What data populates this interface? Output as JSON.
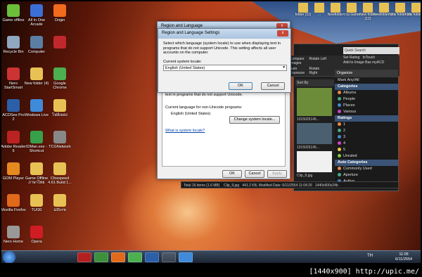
{
  "desktop": {
    "icons": [
      {
        "label": "Game offline",
        "color": "#6bbf3a"
      },
      {
        "label": "Recycle Bin",
        "color": "#8fa7bf"
      },
      {
        "label": "Nero StartSmart",
        "color": "#c33"
      },
      {
        "label": "ACDSee Pro 2",
        "color": "#2c5fa8"
      },
      {
        "label": "Adobe Reader 9",
        "color": "#b22"
      },
      {
        "label": "GOM Player",
        "color": "#e48a1f"
      },
      {
        "label": "Mozilla Firefox",
        "color": "#e06a1a"
      },
      {
        "label": "Nero Home",
        "color": "#999"
      },
      {
        "label": "All In One Arcade",
        "color": "#3b6fd6"
      },
      {
        "label": "Computer",
        "color": "#5b7fa3"
      },
      {
        "label": "New folder (4)",
        "color": "#e8c155"
      },
      {
        "label": "Windows Live",
        "color": "#3f8ad9"
      },
      {
        "label": "IDMan.exe - Shortcut",
        "color": "#38a04a"
      },
      {
        "label": "Game Offline ภาษาไทย",
        "color": "#e8c155"
      },
      {
        "label": "TUI30",
        "color": "#e8c155"
      },
      {
        "label": "Opera",
        "color": "#d01c24"
      },
      {
        "label": "Origin",
        "color": "#f26a1b"
      },
      {
        "label": "",
        "color": "#c0282d"
      },
      {
        "label": "Google Chrome",
        "color": "#4caf50"
      },
      {
        "label": "ไฟล์เพลง",
        "color": "#e8c155"
      },
      {
        "label": "TCGNetwork",
        "color": "#888"
      },
      {
        "label": "Cfosspeed 4.61 Build 1...",
        "color": "#e8c155"
      },
      {
        "label": "ฉบับ+พ",
        "color": "#e8c155"
      }
    ]
  },
  "top_folders": [
    "folder (11)",
    "...",
    "Newfolder",
    "รวม Game",
    "New folder (12)",
    "Newfolder (7)",
    "New folder (3)",
    "New folder (1)"
  ],
  "dialog_front": {
    "title": "Region and Language Settings",
    "close": "x",
    "description": "Select which language (system locale) to use when displaying text in programs that do not support Unicode. This setting affects all user accounts on the computer.",
    "locale_label": "Current system locale:",
    "locale_value": "English (United States)",
    "ok": "OK",
    "cancel": "Cancel"
  },
  "dialog_back": {
    "title": "Region and Language",
    "partial_text": "text in programs that do not support Unicode.",
    "current_label": "Current language for non-Unicode programs:",
    "current_value": "English (United States)",
    "change_button": "Change system locale...",
    "link": "What is system locale?",
    "ok": "OK",
    "cancel": "Cancel",
    "apply": "Apply"
  },
  "acdsee": {
    "toolbar": [
      "Compare Images",
      "Rotate Left",
      "Set Rating",
      "InTouch",
      "Auto Exposure",
      "Rotate Right",
      "Add to Image Bas",
      "myACD"
    ],
    "search": "Quick Search",
    "sort": "Sort By",
    "organize": "Organize",
    "mark": "Mark Any/All",
    "categories_header": "Categories",
    "categories": [
      "Albums",
      "People",
      "Places",
      "Various"
    ],
    "ratings_header": "Ratings",
    "ratings": [
      "1",
      "2",
      "3",
      "4",
      "5",
      "Unrated"
    ],
    "auto_header": "Auto Categories",
    "auto": [
      "Commonly Used",
      "Aperture",
      "Author"
    ],
    "thumbs": [
      "1015025145...",
      "1015025145...",
      "Clip_9.jpg"
    ],
    "status": [
      "Total 16 items (1.6 MB)",
      "Clip_9.jpg",
      "441.2 KB, Modified Date: 6/11/2554 11:04:26",
      "1440x900x24b"
    ]
  },
  "taskbar": {
    "lang": "TH",
    "time": "11:05",
    "date": "6/11/2554"
  },
  "watermark": "[1440x900] http://upic.me/"
}
